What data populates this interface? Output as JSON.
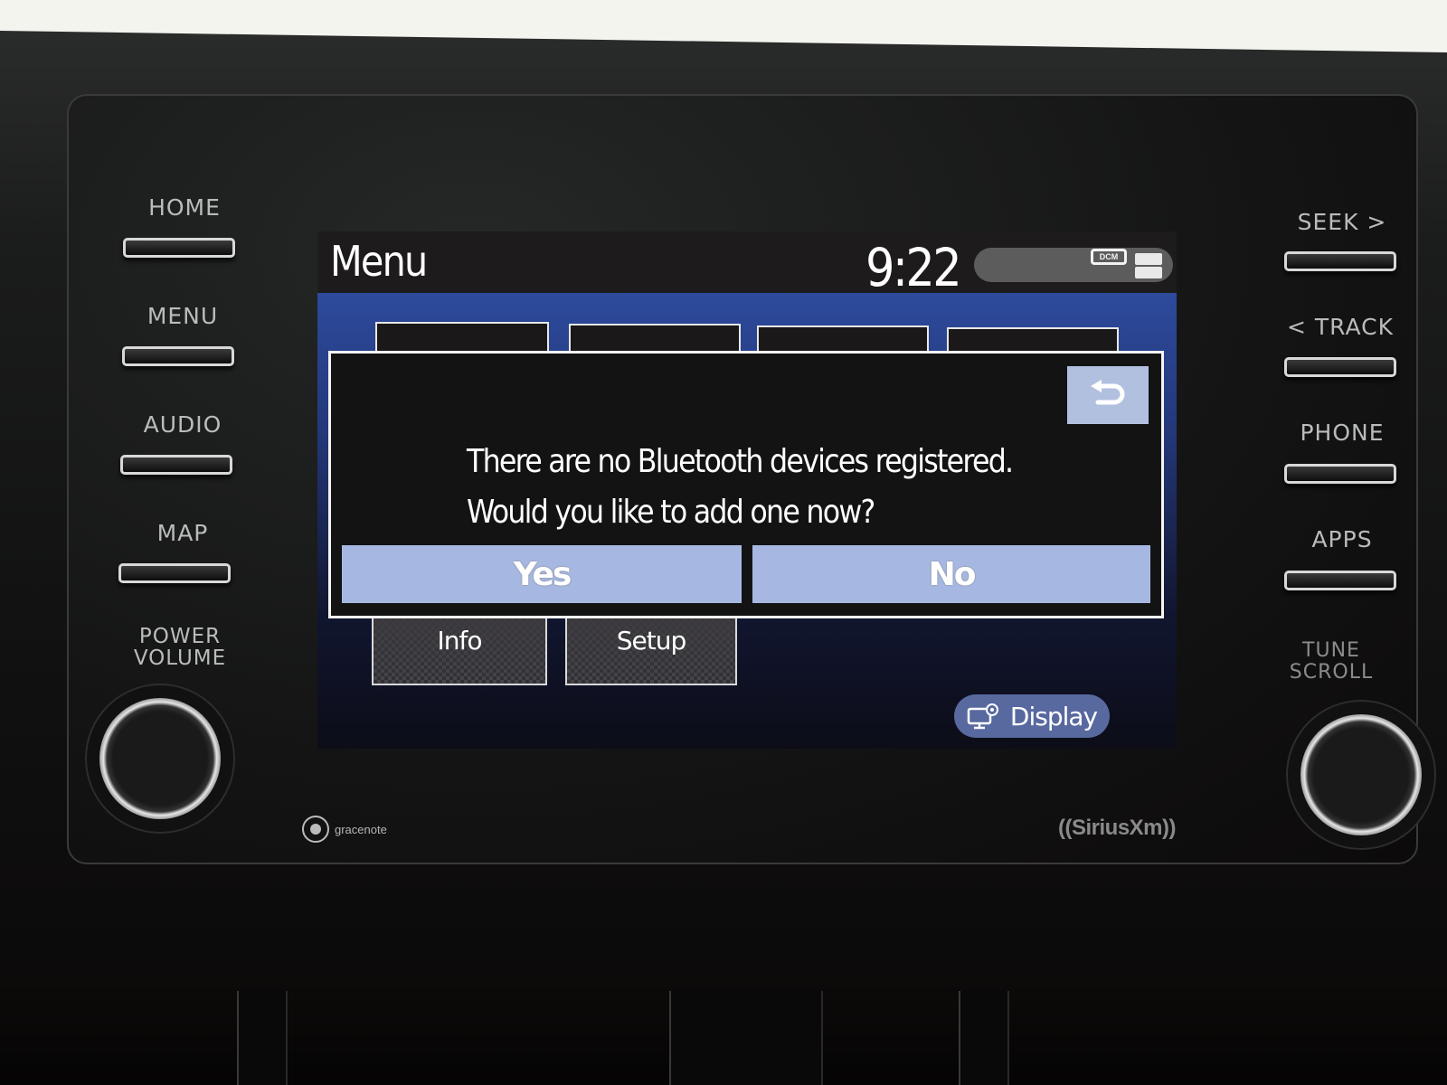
{
  "hardware": {
    "left_buttons": [
      {
        "label": "HOME"
      },
      {
        "label": "MENU"
      },
      {
        "label": "AUDIO"
      },
      {
        "label": "MAP"
      }
    ],
    "left_knob_label": "POWER\nVOLUME",
    "right_buttons": [
      {
        "label": "SEEK >"
      },
      {
        "label": "< TRACK"
      },
      {
        "label": "PHONE"
      },
      {
        "label": "APPS"
      }
    ],
    "right_knob_label": "TUNE\nSCROLL",
    "brand_left": "gracenote",
    "brand_right": "((SiriusXm))"
  },
  "screen": {
    "title": "Menu",
    "clock": "9:22",
    "status_icons": [
      "dcm-icon",
      "signal-icon"
    ],
    "dcm_label": "DCM",
    "menu_tiles_bottom": [
      {
        "label": "Info"
      },
      {
        "label": "Setup"
      }
    ],
    "display_button": {
      "label": "Display",
      "icon": "display-settings-icon"
    }
  },
  "dialog": {
    "message_line1": "There are no Bluetooth devices registered.",
    "message_line2": "Would you like to add one now?",
    "back_icon": "back-arrow-icon",
    "yes_label": "Yes",
    "no_label": "No"
  },
  "colors": {
    "menu_blue": "#2d4a9c",
    "dialog_button": "#a6b8e2",
    "display_pill": "#5869a0"
  }
}
